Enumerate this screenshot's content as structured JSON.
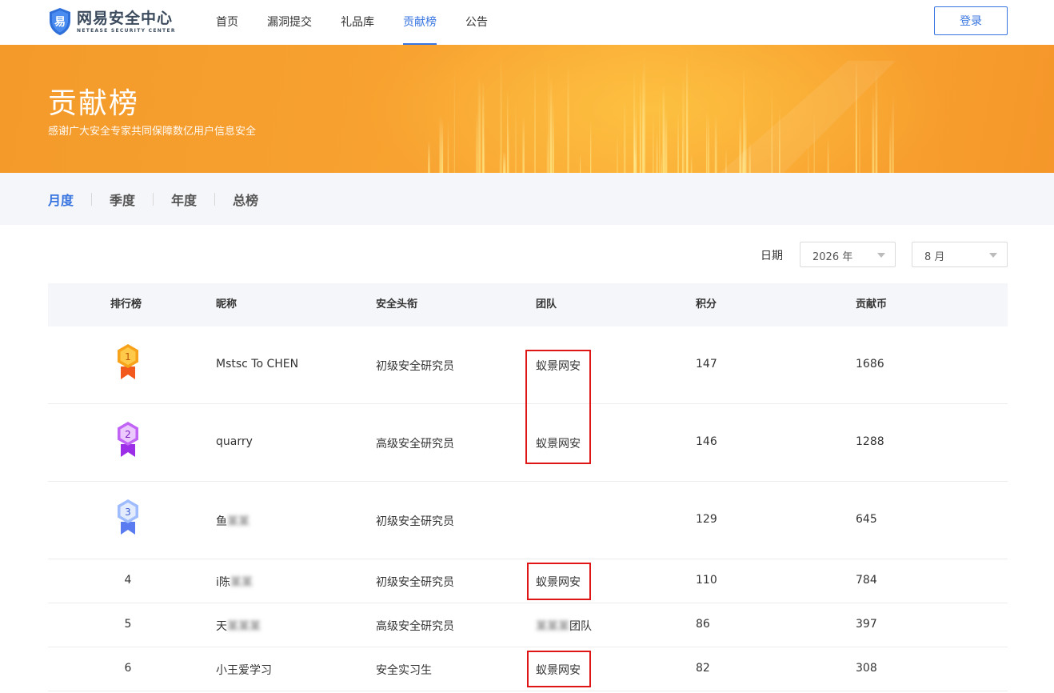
{
  "header": {
    "logo_cn": "网易安全中心",
    "logo_en": "NETEASE SECURITY CENTER",
    "nav": [
      "首页",
      "漏洞提交",
      "礼品库",
      "贡献榜",
      "公告"
    ],
    "active_nav": 3,
    "login_label": "登录"
  },
  "banner": {
    "title": "贡献榜",
    "subtitle": "感谢广大安全专家共同保障数亿用户信息安全"
  },
  "tabs": [
    "月度",
    "季度",
    "年度",
    "总榜"
  ],
  "active_tab": 0,
  "filter": {
    "date_label": "日期",
    "year": "2026 年",
    "month": "8 月"
  },
  "table": {
    "headers": [
      "排行榜",
      "昵称",
      "安全头衔",
      "团队",
      "积分",
      "贡献币"
    ],
    "rows": [
      {
        "rank": "1",
        "nickname": "Mstsc To CHEN",
        "title": "初级安全研究员",
        "team": "蚁景网安",
        "points": "147",
        "coins": "1686"
      },
      {
        "rank": "2",
        "nickname": "quarry",
        "title": "高级安全研究员",
        "team": "蚁景网安",
        "points": "146",
        "coins": "1288"
      },
      {
        "rank": "3",
        "nickname": "鱼",
        "nickname_hidden": "某某",
        "title": "初级安全研究员",
        "team": "",
        "points": "129",
        "coins": "645"
      },
      {
        "rank": "4",
        "nickname": "i陈",
        "nickname_hidden": "某某",
        "title": "初级安全研究员",
        "team": "蚁景网安",
        "points": "110",
        "coins": "784"
      },
      {
        "rank": "5",
        "nickname": "天",
        "nickname_hidden": "某某某",
        "title": "高级安全研究员",
        "team": "团队",
        "team_hidden": "某某某",
        "points": "86",
        "coins": "397"
      },
      {
        "rank": "6",
        "nickname": "小王爱学习",
        "title": "安全实习生",
        "team": "蚁景网安",
        "points": "82",
        "coins": "308"
      }
    ]
  },
  "colors": {
    "accent": "#3875e0",
    "banner": "#f8a231",
    "highlight_box": "#e01515",
    "medal_gold": "#f7a21b",
    "medal_silver_purple": "#b84ff0",
    "medal_bronze_blue": "#7aa6ff"
  }
}
